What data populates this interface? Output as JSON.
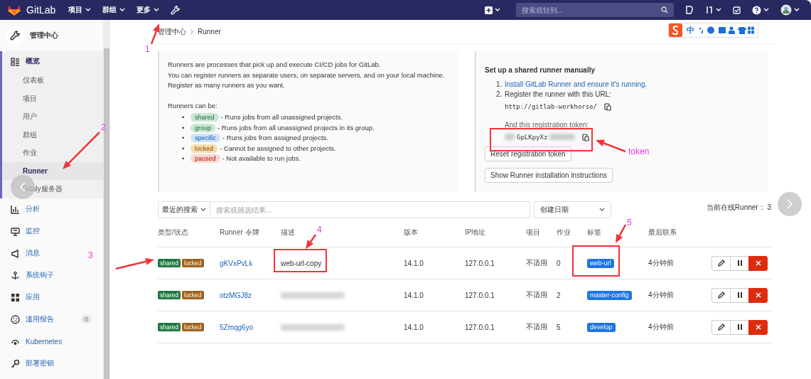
{
  "top_bar": {
    "brand": "GitLab",
    "menus": [
      {
        "label": "项目"
      },
      {
        "label": "群组"
      },
      {
        "label": "更多"
      }
    ],
    "search": {
      "placeholder": "搜索或转到..."
    }
  },
  "ime_bar": {
    "label": "中"
  },
  "sidebar": {
    "title": "管理中心",
    "sections": [
      {
        "label": "概览",
        "active": true,
        "children": [
          {
            "label": "仪表板",
            "selected": false
          },
          {
            "label": "项目",
            "selected": false
          },
          {
            "label": "用户",
            "selected": false
          },
          {
            "label": "群组",
            "selected": false
          },
          {
            "label": "作业",
            "selected": false
          },
          {
            "label": "Runner",
            "selected": true
          },
          {
            "label": "Gitaly服务器",
            "selected": false
          }
        ]
      },
      {
        "label": "分析",
        "active": false
      },
      {
        "label": "监控",
        "active": false
      },
      {
        "label": "消息",
        "active": false
      },
      {
        "label": "系统钩子",
        "active": false
      },
      {
        "label": "应用",
        "active": false
      },
      {
        "label": "滥用报告",
        "active": false,
        "count": "0"
      },
      {
        "label": "Kubernetes",
        "active": false
      },
      {
        "label": "部署密钥",
        "active": false
      }
    ]
  },
  "breadcrumb": [
    "管理中心",
    "Runner"
  ],
  "intro": {
    "lines": [
      "Runners are processes that pick up and execute CI/CD jobs for GitLab.",
      "You can register runners as separate users, on separate servers, and on your local machine.",
      "Register as many runners as you want."
    ],
    "list_title": "Runners can be:",
    "marker": "•",
    "types": [
      {
        "badge": "shared",
        "color": "#c9e8d2",
        "text": "- Runs jobs from all unassigned projects."
      },
      {
        "badge": "group",
        "color": "#c9e8d2",
        "text": "- Runs jobs from all unassigned projects in its group."
      },
      {
        "badge": "specific",
        "color": "#cfe3fa",
        "text": "- Runs jobs from assigned projects."
      },
      {
        "badge": "locked",
        "color": "#f7ddb0",
        "text": "- Cannot be assigned to other projects."
      },
      {
        "badge": "paused",
        "color": "#fcd6d0",
        "text": "- Not available to run jobs."
      }
    ]
  },
  "setup": {
    "title": "Set up a shared runner manually",
    "steps": [
      {
        "kind": "link",
        "number": "1.",
        "text": "Install GitLab Runner and ensure it's running."
      },
      {
        "kind": "text",
        "number": "2.",
        "text": "Register the runner with this URL:"
      }
    ],
    "url": "http://gitlab-workhorse/",
    "token_label": "And this registration token:",
    "token": "GpLKpyXz",
    "buttons": [
      "Reset registration token",
      "Show Runner installation instructions"
    ]
  },
  "filter": {
    "recent": "最近的搜索",
    "placeholder": "搜索或筛选结果...",
    "sort": "创建日期"
  },
  "online": "当前在线Runner： 3",
  "table": {
    "columns": [
      "类型/状态",
      "Runner 令牌",
      "描述",
      "版本",
      "IP地址",
      "项目",
      "作业",
      "标签",
      "最后联系"
    ],
    "rows": [
      {
        "badges": [
          {
            "label": "shared",
            "color": "#217a3f"
          },
          {
            "label": "locked",
            "color": "#a0601a"
          }
        ],
        "token": "gKVxPvLk",
        "blurred": false,
        "description": "web-url-copy",
        "version": "14.1.0",
        "ip": "127.0.0.1",
        "projects": "不适用",
        "jobs": "0",
        "tag": "web-url",
        "last": "4分钟前"
      },
      {
        "badges": [
          {
            "label": "shared",
            "color": "#217a3f"
          },
          {
            "label": "locked",
            "color": "#a0601a"
          }
        ],
        "token": "otzMGJ8z",
        "blurred": true,
        "version": "14.1.0",
        "ip": "127.0.0.1",
        "projects": "不适用",
        "jobs": "2",
        "tag": "master-config",
        "last": "4分钟前"
      },
      {
        "badges": [
          {
            "label": "shared",
            "color": "#217a3f"
          },
          {
            "label": "locked",
            "color": "#a0601a"
          }
        ],
        "token": "5Zmqg6yo",
        "blurred": true,
        "version": "14.1.0",
        "ip": "127.0.0.1",
        "projects": "不适用",
        "jobs": "5",
        "tag": "develop",
        "last": "4分钟前"
      }
    ]
  },
  "annotations": {
    "numbers": [
      "1",
      "2",
      "3",
      "4",
      "5"
    ],
    "token_note": "token"
  }
}
